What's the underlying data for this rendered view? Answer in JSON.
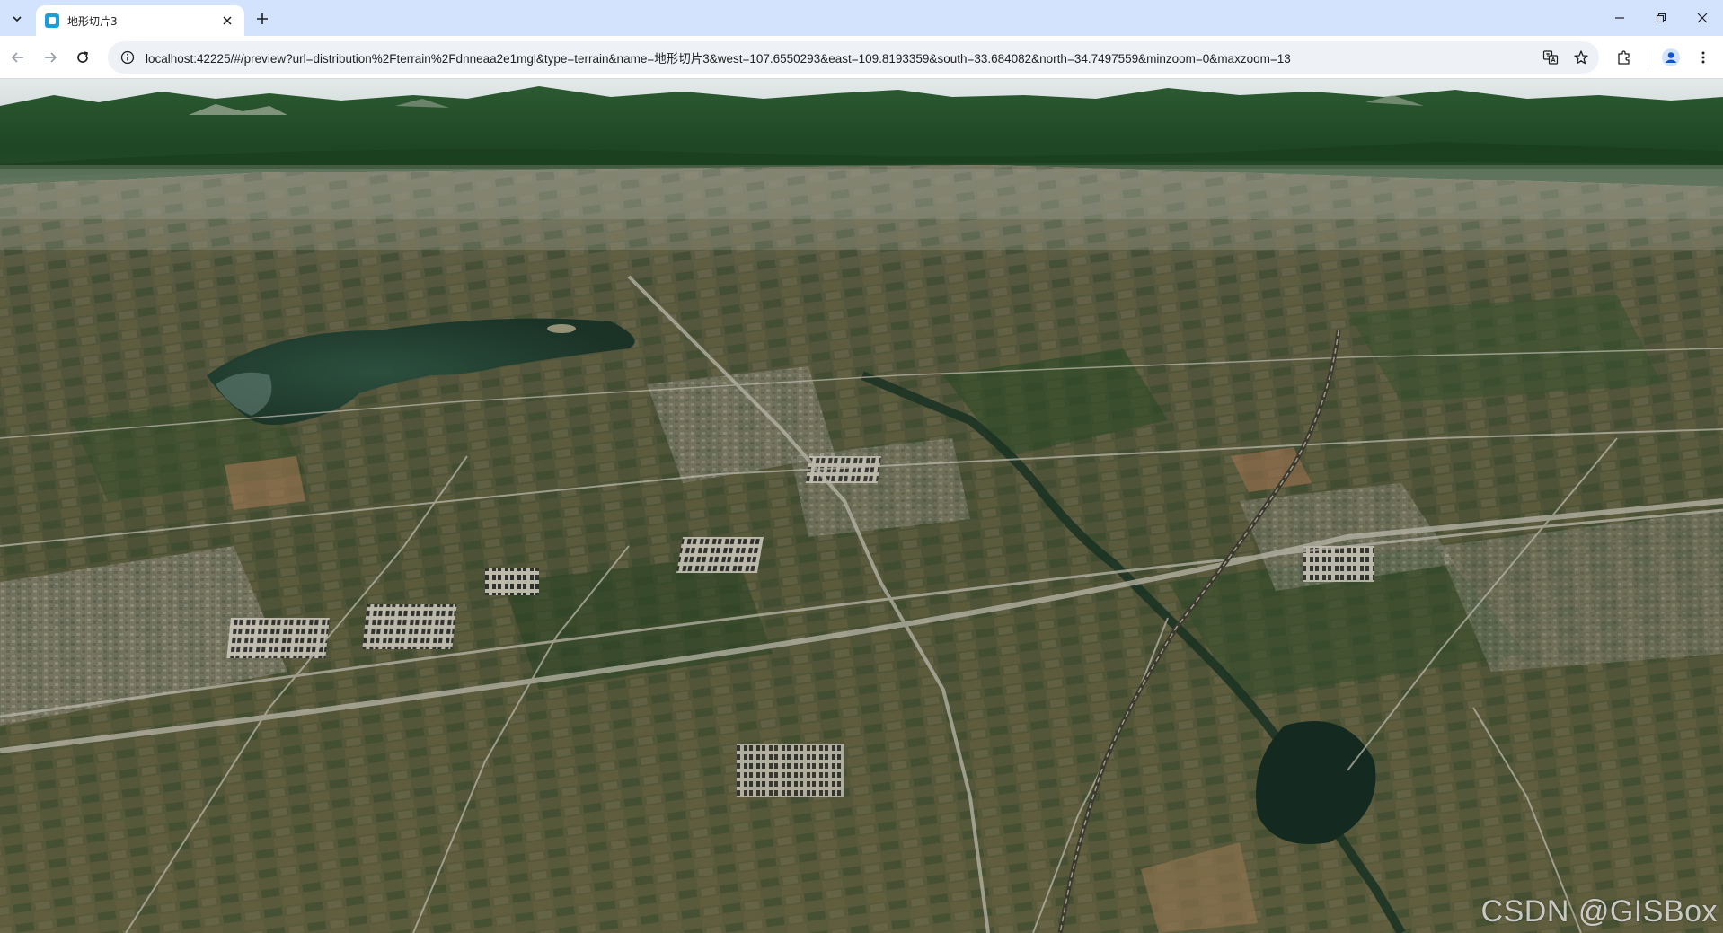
{
  "browser": {
    "tab": {
      "title": "地形切片3"
    },
    "address_bar": {
      "url": "localhost:42225/#/preview?url=distribution%2Fterrain%2Fdnneaa2e1mgl&type=terrain&name=地形切片3&west=107.6550293&east=109.8193359&south=33.684082&north=34.7497559&minzoom=0&maxzoom=13"
    },
    "icons": {
      "tab_search": "chevron-down-icon",
      "tab_close": "close-icon",
      "new_tab": "plus-icon",
      "back": "arrow-left-icon",
      "forward": "arrow-right-icon",
      "reload": "reload-icon",
      "site_info": "info-icon",
      "translate": "translate-icon",
      "bookmark": "star-icon",
      "extensions": "puzzle-icon",
      "profile": "profile-icon",
      "menu": "kebab-menu-icon",
      "minimize": "minimize-icon",
      "restore": "restore-icon",
      "close_window": "close-icon"
    }
  },
  "viewer": {
    "watermark": "CSDN @GISBox"
  },
  "colors": {
    "tabstrip": "#d3e3fd",
    "terrain_forest": "#1f4a25",
    "terrain_plain": "#5a5536",
    "water": "#1f3a2c"
  }
}
